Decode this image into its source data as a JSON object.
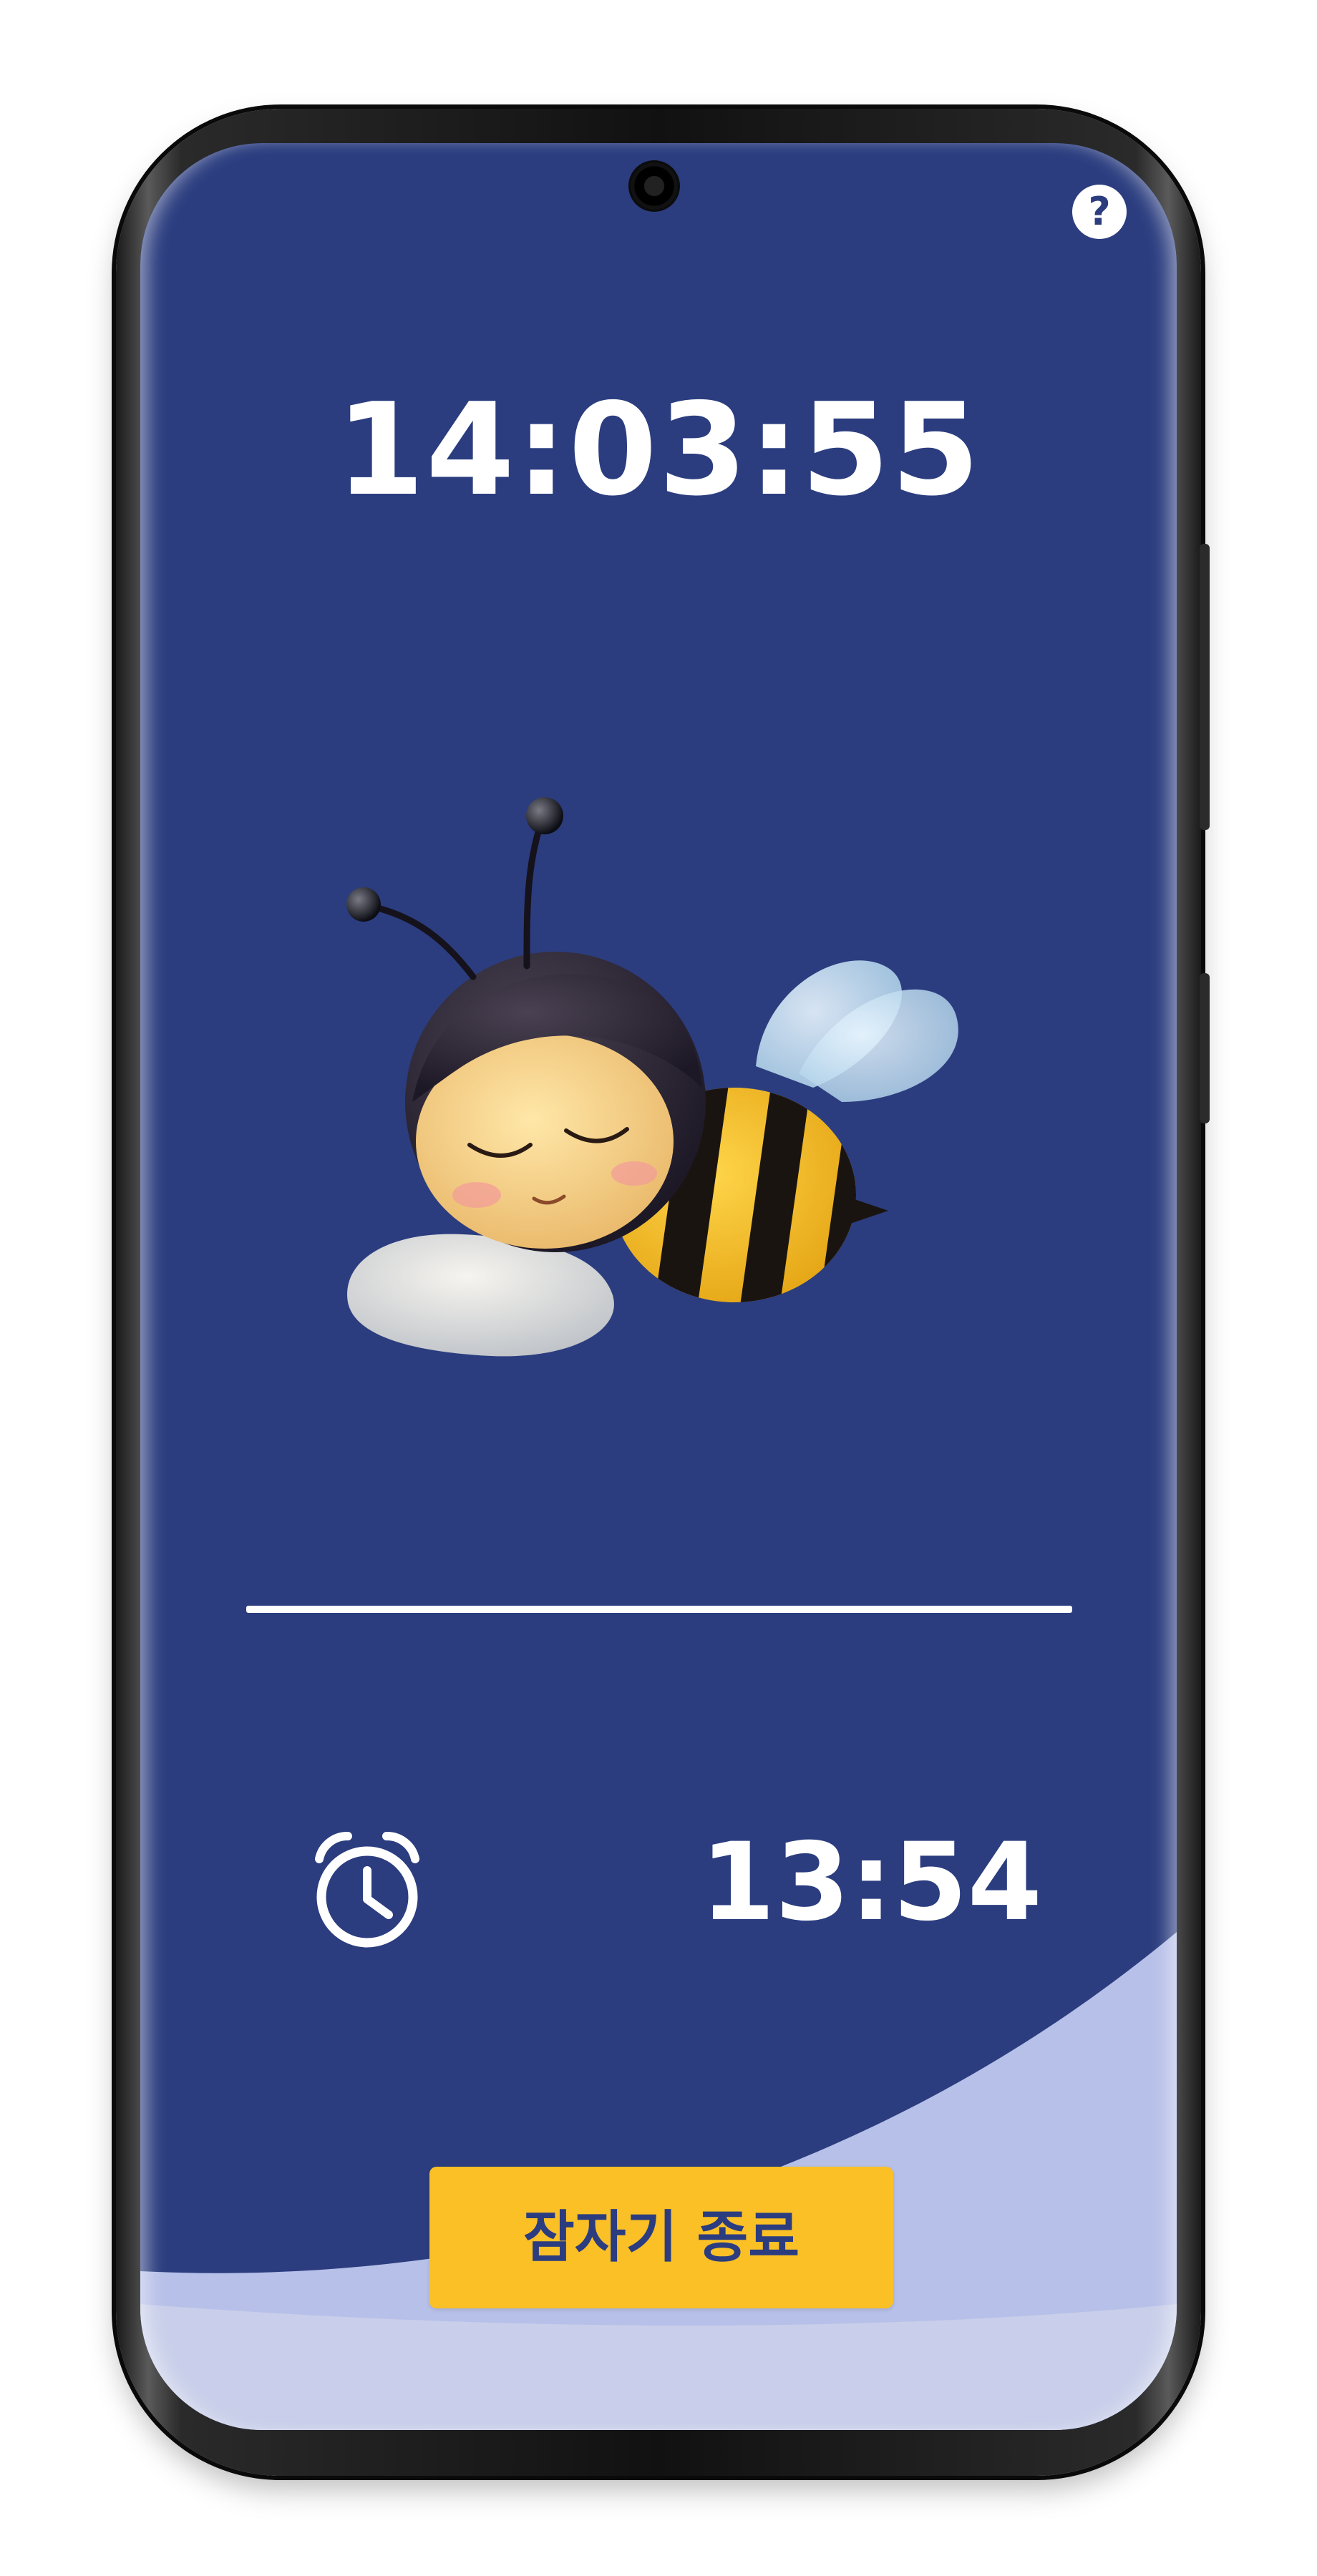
{
  "screen": {
    "current_time": "14:03:55",
    "alarm_time": "13:54",
    "end_sleep_button_label": "잠자기 종료",
    "help_label": "?",
    "illustration": "sleeping-bee-on-pillow"
  },
  "icons": {
    "help": "question-mark-icon",
    "alarm": "alarm-clock-icon",
    "camera": "front-camera"
  },
  "colors": {
    "screen_background": "#2b3d7f",
    "bottom_wave": "#c7cdea",
    "button_background": "#fbc026",
    "button_text": "#2b3d7f",
    "text": "#ffffff"
  }
}
